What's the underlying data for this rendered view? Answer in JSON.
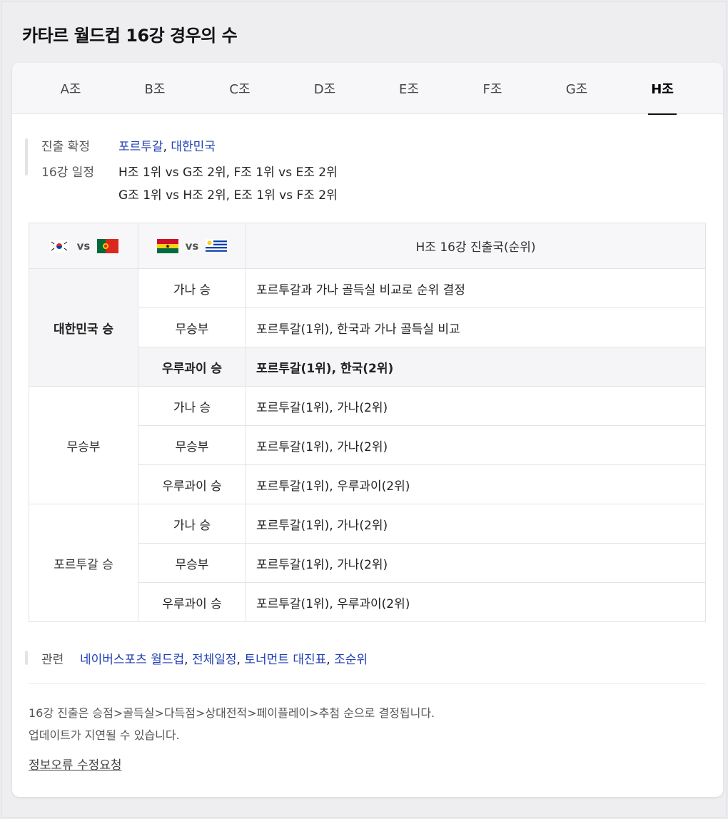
{
  "page": {
    "title": "카타르 월드컵 16강 경우의 수"
  },
  "tabs": [
    "A조",
    "B조",
    "C조",
    "D조",
    "E조",
    "F조",
    "G조",
    "H조"
  ],
  "active_tab": "H조",
  "info": {
    "confirmed_label": "진출 확정",
    "confirmed_teams": [
      "포르투갈",
      "대한민국"
    ],
    "schedule_label": "16강 일정",
    "schedule_lines": [
      "H조 1위 vs G조 2위, F조 1위 vs E조 2위",
      "G조 1위 vs H조 2위, E조 1위 vs F조 2위"
    ]
  },
  "table": {
    "match1": {
      "vs": "vs",
      "home_flag": "korea-flag-icon",
      "away_flag": "portugal-flag-icon"
    },
    "match2": {
      "vs": "vs",
      "home_flag": "ghana-flag-icon",
      "away_flag": "uruguay-flag-icon"
    },
    "result_header": "H조 16강 진출국(순위)",
    "groups": [
      {
        "label": "대한민국 승",
        "rows": [
          {
            "outcome": "가나 승",
            "result": "포르투갈과 가나 골득실 비교로 순위 결정"
          },
          {
            "outcome": "무승부",
            "result": "포르투갈(1위), 한국과 가나 골득실 비교"
          },
          {
            "outcome": "우루과이 승",
            "result": "포르투갈(1위), 한국(2위)"
          }
        ]
      },
      {
        "label": "무승부",
        "rows": [
          {
            "outcome": "가나 승",
            "result": "포르투갈(1위), 가나(2위)"
          },
          {
            "outcome": "무승부",
            "result": "포르투갈(1위), 가나(2위)"
          },
          {
            "outcome": "우루과이 승",
            "result": "포르투갈(1위), 우루과이(2위)"
          }
        ]
      },
      {
        "label": "포르투갈 승",
        "rows": [
          {
            "outcome": "가나 승",
            "result": "포르투갈(1위), 가나(2위)"
          },
          {
            "outcome": "무승부",
            "result": "포르투갈(1위), 가나(2위)"
          },
          {
            "outcome": "우루과이 승",
            "result": "포르투갈(1위), 우루과이(2위)"
          }
        ]
      }
    ]
  },
  "related": {
    "label": "관련",
    "links": [
      "네이버스포츠 월드컵",
      "전체일정",
      "토너먼트 대진표",
      "조순위"
    ]
  },
  "notes": [
    "16강 진출은 승점>골득실>다득점>상대전적>페이플레이>추첨 순으로 결정됩니다.",
    "업데이트가 지연될 수 있습니다."
  ],
  "report_link": "정보오류 수정요청",
  "colors": {
    "link": "#1f3fb5",
    "background": "#eeeef1",
    "highlight_row": "#f5f5f7"
  }
}
